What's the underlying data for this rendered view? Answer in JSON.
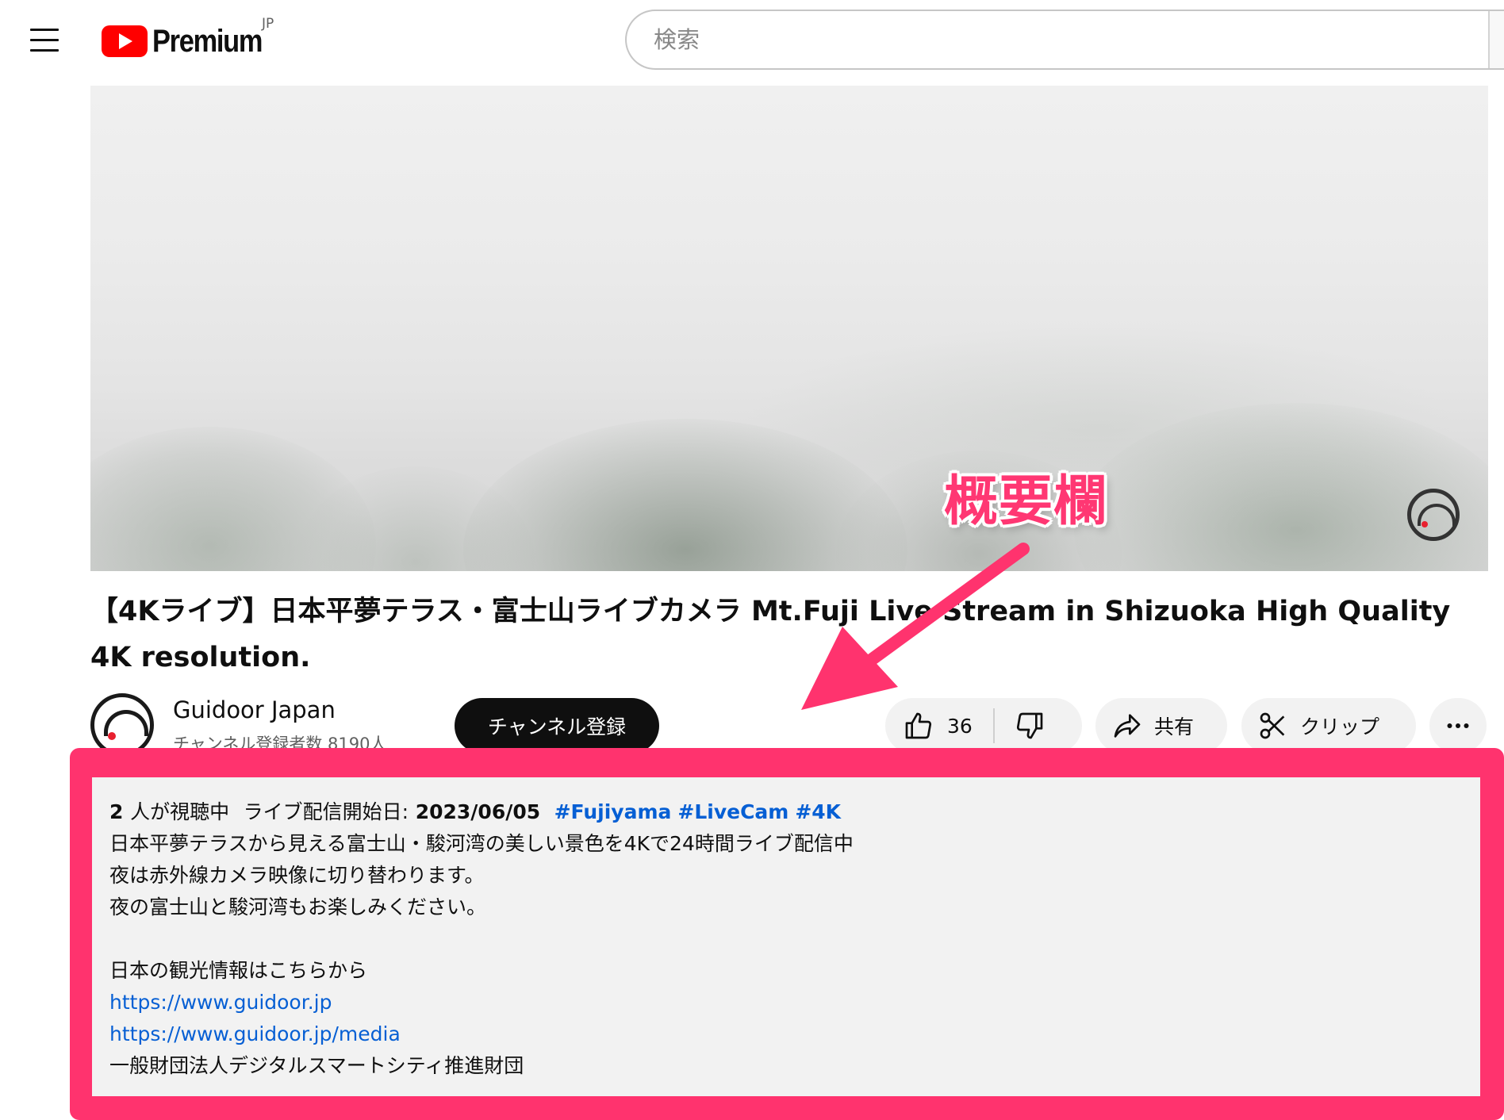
{
  "header": {
    "logo_text": "Premium",
    "region_badge": "JP",
    "search_placeholder": "検索"
  },
  "video": {
    "title": "【4Kライブ】日本平夢テラス・富士山ライブカメラ Mt.Fuji Live Stream in Shizuoka High Quality 4K resolution."
  },
  "channel": {
    "name": "Guidoor Japan",
    "subscribers": "チャンネル登録者数 8190人",
    "subscribe_label": "チャンネル登録"
  },
  "actions": {
    "like_count": "36",
    "share_label": "共有",
    "clip_label": "クリップ"
  },
  "description": {
    "viewers_count": "2",
    "viewers_suffix": "人が視聴中",
    "stream_label": "ライブ配信開始日:",
    "stream_date": "2023/06/05",
    "hashtags": [
      "#Fujiyama",
      "#LiveCam",
      "#4K"
    ],
    "lines": [
      "日本平夢テラスから見える富士山・駿河湾の美しい景色を4Kで24時間ライブ配信中",
      "夜は赤外線カメラ映像に切り替わります。",
      "夜の富士山と駿河湾もお楽しみください。",
      "",
      "日本の観光情報はこちらから"
    ],
    "links": [
      "https://www.guidoor.jp",
      "https://www.guidoor.jp/media"
    ],
    "footer": "一般財団法人デジタルスマートシティ推進財団"
  },
  "annotation": {
    "label": "概要欄",
    "color": "#ff336e"
  },
  "colors": {
    "brand_red": "#ff0000",
    "link_blue": "#065fd4",
    "highlight": "#ff336e"
  }
}
